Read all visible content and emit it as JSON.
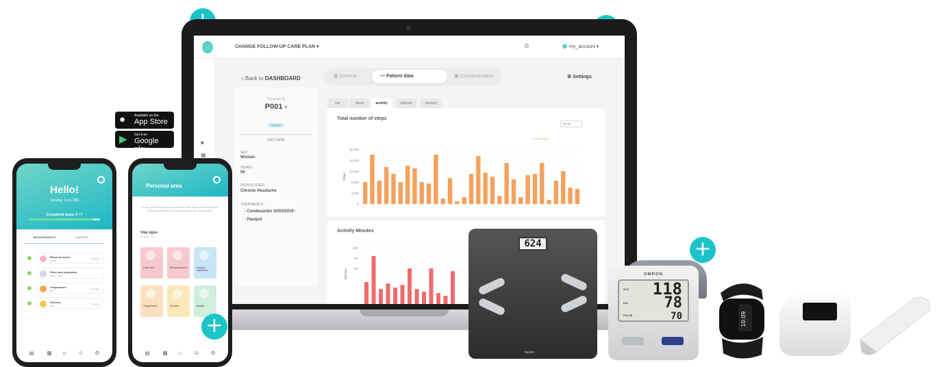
{
  "web": {
    "plan_label": "CHANGE FOLLOW-UP CARE PLAN ▾",
    "account_label": "my_account ▾",
    "back_label": "Back to",
    "back_bold": "DASHBOARD",
    "tabs": [
      "General",
      "Patient data",
      "Communication"
    ],
    "settings_label": "Settings",
    "patient": {
      "id_label": "Personal ID",
      "id": "P001 -",
      "badge": "Vigente",
      "edit": "EDIT DATA",
      "sex_label": "SEX:",
      "sex": "Woman",
      "years_label": "YEARS:",
      "years": "56",
      "pathologies_label": "PATHOLOGIES:",
      "pathologies": "Chronic Headache",
      "treatments_label": "TREATMENTS:",
      "treatment_1": "- Candesartán 10/03/2019 -",
      "treatment_2": "- Panipril"
    },
    "subtabs": [
      "csv",
      "sleep",
      "activity",
      "analysis",
      "surveys"
    ]
  },
  "chart_data": [
    {
      "type": "bar",
      "title": "Total number of steps",
      "ylabel": "Steps",
      "legend": "Total steps",
      "period": "Month",
      "yticks": [
        "0",
        "4.000",
        "8.000",
        "12.000",
        "16.000",
        "20.000"
      ],
      "ylim": [
        0,
        20000
      ],
      "values": [
        8000,
        18000,
        8500,
        13500,
        11000,
        8000,
        14000,
        13000,
        8000,
        7500,
        18000,
        2000,
        9500,
        1000,
        2500,
        11000,
        17500,
        11500,
        10000,
        3000,
        15000,
        9000,
        2500,
        10500,
        11000,
        15000,
        1500,
        8500,
        12000,
        6000,
        5500
      ],
      "color": "#f5a15c"
    },
    {
      "type": "bar",
      "title": "Activity Minutes",
      "ylabel": "Minutes",
      "yticks": [
        "80",
        "90",
        "100"
      ],
      "color": "#ef6b6b"
    }
  ],
  "app_store": {
    "small": "Available on the",
    "big": "App Store"
  },
  "google_play": {
    "small": "Get it on",
    "big": "Google play"
  },
  "phone1": {
    "greeting": "Hello!",
    "date": "Tuesday, June 28th",
    "completed": "Completed tasks: 5 / 7",
    "progress": 0.9,
    "tab_left": "MEASUREMENTS",
    "tab_right": "SURVEYS",
    "items": [
      {
        "name": "Blood pressure",
        "sub": "120/80",
        "right": "Set today ›"
      },
      {
        "name": "Pulse and saturation",
        "sub": "88bpm · 95%",
        "right": ""
      },
      {
        "name": "Temperature",
        "sub": "36,5º",
        "right": "Set today ›"
      },
      {
        "name": "Glucose",
        "sub": "90%",
        "right": "Set today ›"
      }
    ]
  },
  "phone2": {
    "title": "Personal area",
    "desc": "In your personal area you can access the data about your medical team. Select a measurement or survey to see its data and evolution.",
    "vitals_title": "Vital signs",
    "vitals_sub": "Fri 21 AM · Ago",
    "tiles": [
      "Heart rate",
      "Blood pressure",
      "Oxygen saturation",
      "Temperature",
      "Glucose",
      "Weight"
    ]
  },
  "devices": {
    "scale_reading": "624",
    "scale_brand": "beurer",
    "bp_brand": "OMRON",
    "sys": "118",
    "dia": "78",
    "pulse": "70",
    "sys_label": "SYS",
    "dia_label": "DIA",
    "pulse_label": "PULSE",
    "band_time": "10:09"
  },
  "colors": {
    "accent": "#1cc4c8",
    "steps": "#f5a15c",
    "minutes": "#ef6b6b"
  }
}
